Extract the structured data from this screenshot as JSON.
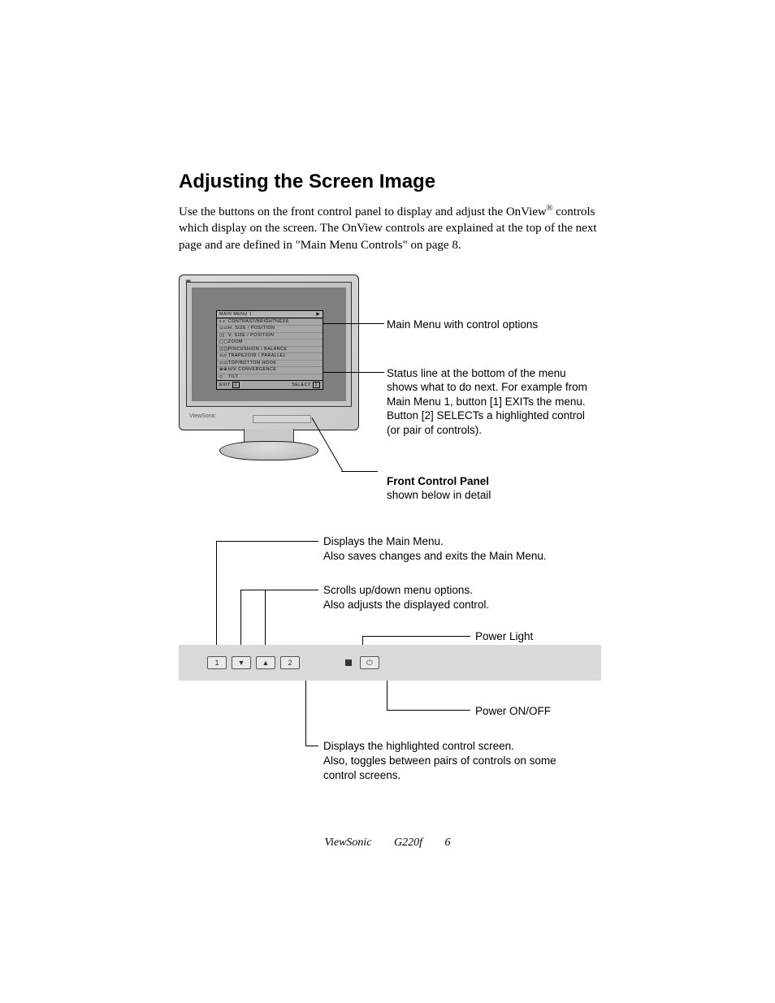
{
  "heading": "Adjusting the Screen Image",
  "intro_a": "Use the buttons on the front control panel to display and adjust the OnView",
  "intro_reg": "®",
  "intro_b": " controls which display on the screen. The OnView controls are explained at the top of the next page and are defined in \"Main Menu Controls\" on page 8.",
  "osd": {
    "title": "MAIN MENU 1",
    "arrow": "▶",
    "items": [
      "CONTRAST/BRIGHTNESS",
      "H. SIZE / POSITION",
      "V. SIZE / POSITION",
      "ZOOM",
      "PINCUSHION / BALANCE",
      "TRAPEZOID / PARALLEL",
      "TOP/BOTTOM HOOK",
      "H/V CONVERGENCE",
      "TILT"
    ],
    "exit": "EXIT",
    "exit_btn": "1",
    "select": "SELECT",
    "select_btn": "2"
  },
  "monitor_brand": "ViewSonic",
  "callouts": {
    "main_menu": "Main Menu with control options",
    "status": "Status line at the bottom of the menu shows what to do next. For example from Main Menu 1, button [1] EXITs the menu. Button [2] SELECTs a highlighted control (or pair of controls).",
    "front_panel_title": "Front Control Panel",
    "front_panel_sub": "shown below in detail"
  },
  "panel": {
    "btn1": "1",
    "btn_down": "▼",
    "btn_up": "▲",
    "btn2": "2",
    "power_icon": "⏻",
    "c1a": "Displays the Main Menu.",
    "c1b": "Also saves changes and exits the Main Menu.",
    "c2a": "Scrolls up/down menu options.",
    "c2b": "Also adjusts the displayed control.",
    "c3": "Power Light",
    "c4a": "Displays the highlighted control screen.",
    "c4b": "Also, toggles between pairs of controls on some control screens.",
    "c5": "Power ON/OFF"
  },
  "footer": {
    "brand": "ViewSonic",
    "model": "G220f",
    "page": "6"
  }
}
